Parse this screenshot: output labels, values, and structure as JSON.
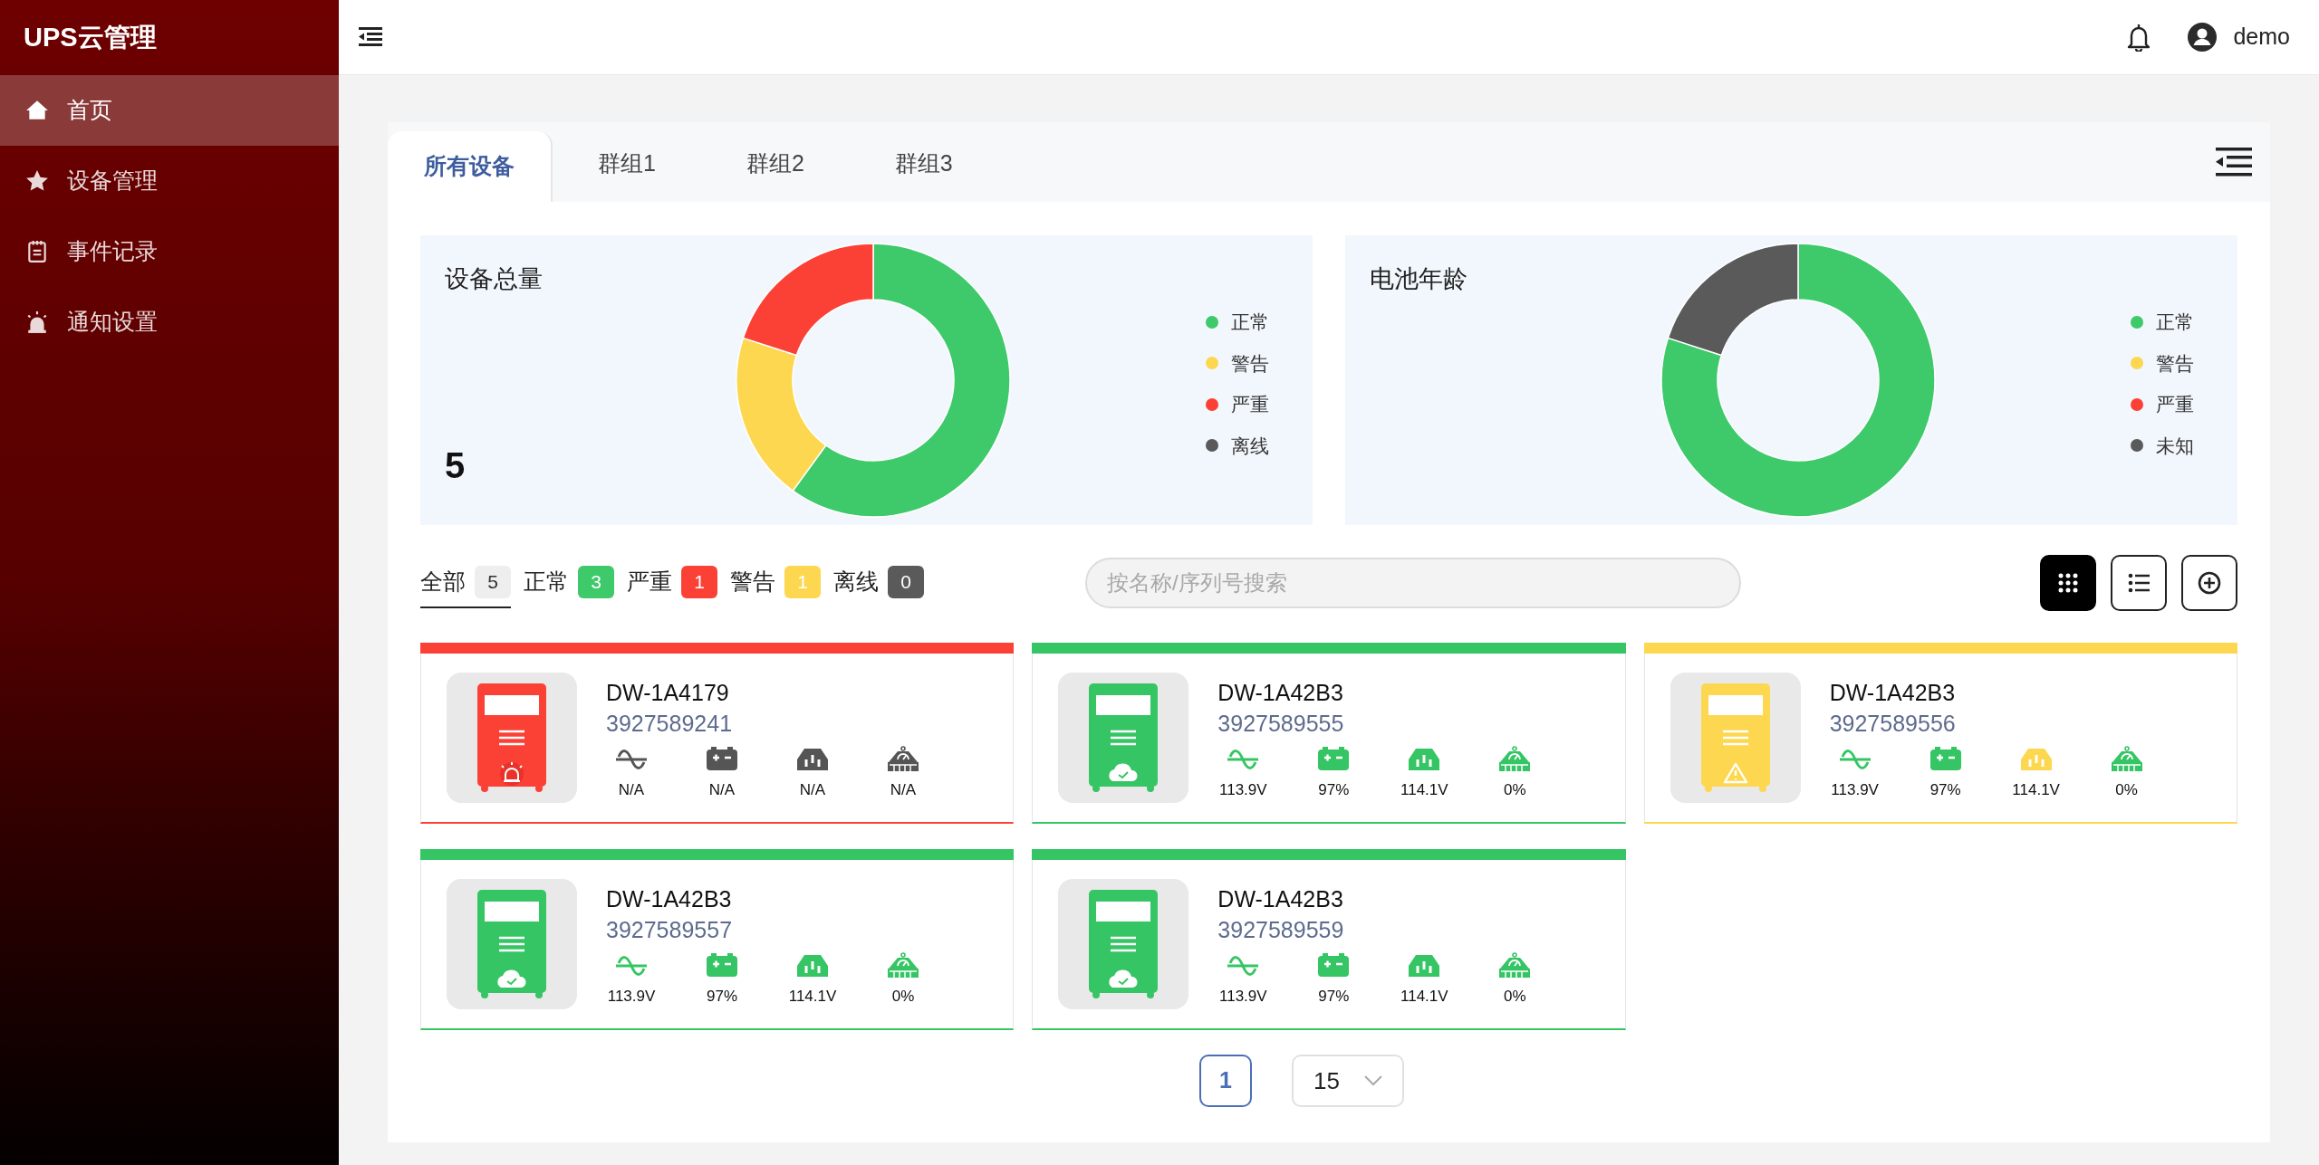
{
  "sidebar": {
    "title": "UPS云管理",
    "items": [
      {
        "label": "首页",
        "kind": "home",
        "selected": true
      },
      {
        "label": "设备管理",
        "kind": "star",
        "selected": false
      },
      {
        "label": "事件记录",
        "kind": "clipboard",
        "selected": false
      },
      {
        "label": "通知设置",
        "kind": "alarm",
        "selected": false
      }
    ]
  },
  "header": {
    "user": "demo"
  },
  "tabs": [
    {
      "label": "所有设备",
      "selected": true
    },
    {
      "label": "群组1",
      "selected": false
    },
    {
      "label": "群组2",
      "selected": false
    },
    {
      "label": "群组3",
      "selected": false
    }
  ],
  "charts": [
    {
      "total": "5",
      "chart_data": {
        "type": "donut",
        "title": "设备总量",
        "categories": [
          "正常",
          "警告",
          "严重",
          "离线"
        ],
        "values": [
          60,
          20,
          20,
          0
        ],
        "colors": [
          "#3ec96a",
          "#fdd74f",
          "#fb4136",
          "#5a5a5a"
        ]
      }
    },
    {
      "chart_data": {
        "type": "donut",
        "title": "电池年龄",
        "categories": [
          "正常",
          "警告",
          "严重",
          "未知"
        ],
        "values": [
          80,
          0,
          0,
          20
        ],
        "colors": [
          "#3ec96a",
          "#fdd74f",
          "#fb4136",
          "#5a5a5a"
        ]
      }
    }
  ],
  "filters": [
    {
      "label": "全部",
      "count": "5",
      "color": "#eeeeee",
      "selected": true
    },
    {
      "label": "正常",
      "count": "3",
      "color": "#3ec96a",
      "selected": false
    },
    {
      "label": "严重",
      "count": "1",
      "color": "#fb4136",
      "selected": false
    },
    {
      "label": "警告",
      "count": "1",
      "color": "#fdd74f",
      "selected": false
    },
    {
      "label": "离线",
      "count": "0",
      "color": "#5a5a5a",
      "selected": false
    }
  ],
  "search": {
    "placeholder": "按名称/序列号搜索"
  },
  "view_buttons": [
    {
      "kind": "grid",
      "selected": true
    },
    {
      "kind": "list",
      "selected": false
    },
    {
      "kind": "add",
      "selected": false
    }
  ],
  "devices": [
    {
      "name": "DW-1A4179",
      "serial": "3927589241",
      "kind": "alarm",
      "color": "#fb4136",
      "metrics": [
        {
          "kind": "input",
          "value": "N/A",
          "color": "#555555"
        },
        {
          "kind": "battery",
          "value": "N/A",
          "color": "#555555"
        },
        {
          "kind": "output",
          "value": "N/A",
          "color": "#555555"
        },
        {
          "kind": "load",
          "value": "N/A",
          "color": "#555555"
        }
      ]
    },
    {
      "name": "DW-1A42B3",
      "serial": "3927589555",
      "kind": "ok",
      "color": "#36c564",
      "metrics": [
        {
          "kind": "input",
          "value": "113.9V",
          "color": "#36c564"
        },
        {
          "kind": "battery",
          "value": "97%",
          "color": "#36c564"
        },
        {
          "kind": "output",
          "value": "114.1V",
          "color": "#36c564"
        },
        {
          "kind": "load",
          "value": "0%",
          "color": "#36c564"
        }
      ]
    },
    {
      "name": "DW-1A42B3",
      "serial": "3927589556",
      "kind": "warning",
      "color": "#fdd74f",
      "metrics": [
        {
          "kind": "input",
          "value": "113.9V",
          "color": "#36c564"
        },
        {
          "kind": "battery",
          "value": "97%",
          "color": "#36c564"
        },
        {
          "kind": "output",
          "value": "114.1V",
          "color": "#fdd74f"
        },
        {
          "kind": "load",
          "value": "0%",
          "color": "#36c564"
        }
      ]
    },
    {
      "name": "DW-1A42B3",
      "serial": "3927589557",
      "kind": "ok",
      "color": "#36c564",
      "metrics": [
        {
          "kind": "input",
          "value": "113.9V",
          "color": "#36c564"
        },
        {
          "kind": "battery",
          "value": "97%",
          "color": "#36c564"
        },
        {
          "kind": "output",
          "value": "114.1V",
          "color": "#36c564"
        },
        {
          "kind": "load",
          "value": "0%",
          "color": "#36c564"
        }
      ]
    },
    {
      "name": "DW-1A42B3",
      "serial": "3927589559",
      "kind": "ok",
      "color": "#36c564",
      "metrics": [
        {
          "kind": "input",
          "value": "113.9V",
          "color": "#36c564"
        },
        {
          "kind": "battery",
          "value": "97%",
          "color": "#36c564"
        },
        {
          "kind": "output",
          "value": "114.1V",
          "color": "#36c564"
        },
        {
          "kind": "load",
          "value": "0%",
          "color": "#36c564"
        }
      ]
    }
  ],
  "pagination": {
    "pages": [
      {
        "label": "1",
        "selected": true
      }
    ],
    "page_size": "15"
  }
}
